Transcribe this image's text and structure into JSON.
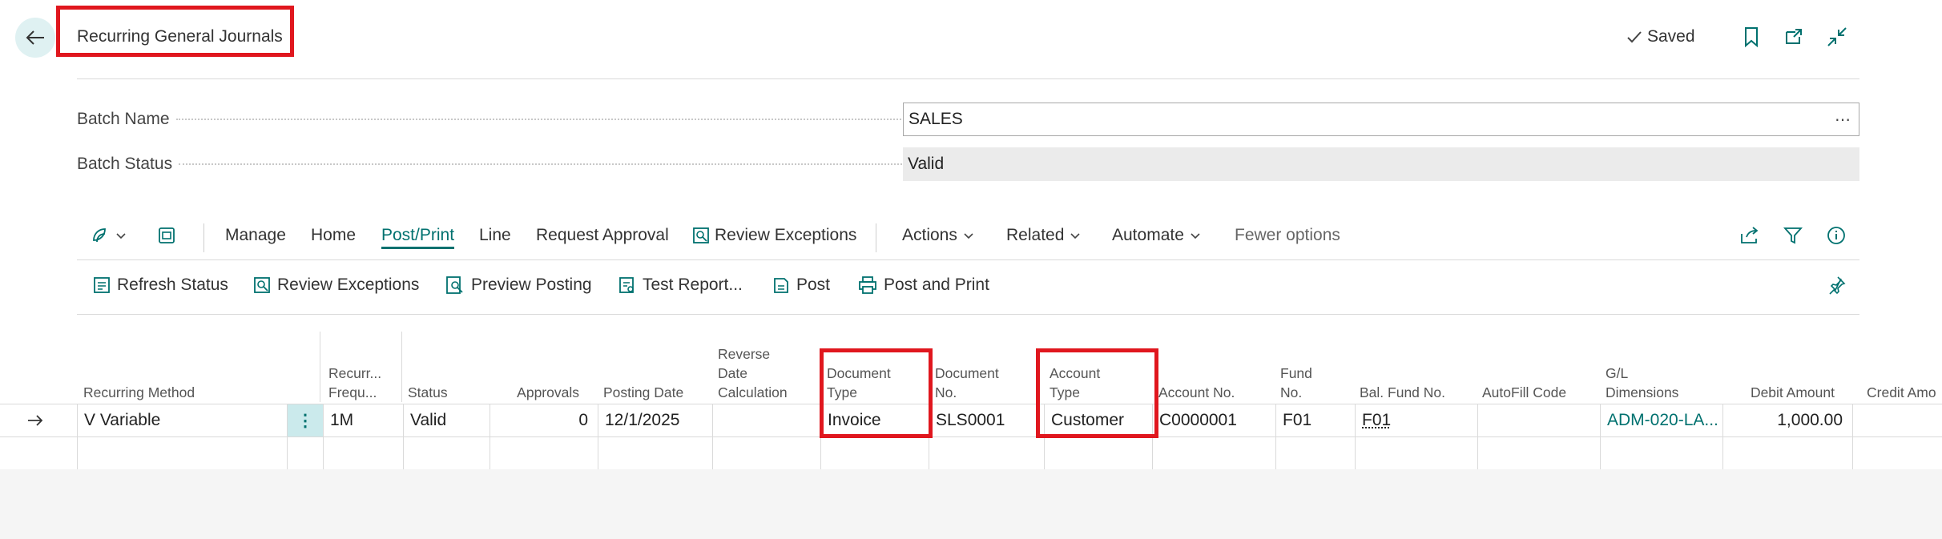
{
  "header": {
    "title": "Recurring General Journals",
    "saved_label": "Saved"
  },
  "fields": {
    "batch_name_label": "Batch Name",
    "batch_name_value": "SALES",
    "batch_name_more": "⋯",
    "batch_status_label": "Batch Status",
    "batch_status_value": "Valid"
  },
  "menu": {
    "manage": "Manage",
    "home": "Home",
    "post_print": "Post/Print",
    "line": "Line",
    "request_approval": "Request Approval",
    "review_exceptions": "Review Exceptions",
    "actions": "Actions",
    "related": "Related",
    "automate": "Automate",
    "fewer_options": "Fewer options"
  },
  "actions": {
    "refresh_status": "Refresh Status",
    "review_exceptions": "Review Exceptions",
    "preview_posting": "Preview Posting",
    "test_report": "Test Report...",
    "post": "Post",
    "post_and_print": "Post and Print"
  },
  "columns": {
    "recurring_method": "Recurring Method",
    "recurring_frequency_1": "Recurr...",
    "recurring_frequency_2": "Frequ...",
    "status": "Status",
    "approvals": "Approvals",
    "posting_date": "Posting Date",
    "reverse_date_1": "Reverse",
    "reverse_date_2": "Date",
    "reverse_date_3": "Calculation",
    "document_type_1": "Document",
    "document_type_2": "Type",
    "document_no_1": "Document",
    "document_no_2": "No.",
    "account_type_1": "Account",
    "account_type_2": "Type",
    "account_no": "Account No.",
    "fund_no_1": "Fund",
    "fund_no_2": "No.",
    "bal_fund_no": "Bal. Fund No.",
    "autofill_code": "AutoFill Code",
    "gl_dimensions_1": "G/L",
    "gl_dimensions_2": "Dimensions",
    "debit_amount": "Debit Amount",
    "credit_amount": "Credit Amo"
  },
  "row": {
    "recurring_method": "V Variable",
    "row_menu": "⋮",
    "recurring_frequency": "1M",
    "status": "Valid",
    "approvals": "0",
    "posting_date": "12/1/2025",
    "reverse_date": "",
    "document_type": "Invoice",
    "document_no": "SLS0001",
    "account_type": "Customer",
    "account_no": "C0000001",
    "fund_no": "F01",
    "bal_fund_no": "F01",
    "autofill_code": "",
    "gl_dimensions": "ADM-020-LA...",
    "debit_amount": "1,000.00",
    "credit_amount": ""
  },
  "colors": {
    "accent": "#00716f",
    "highlight": "#e0171e"
  }
}
